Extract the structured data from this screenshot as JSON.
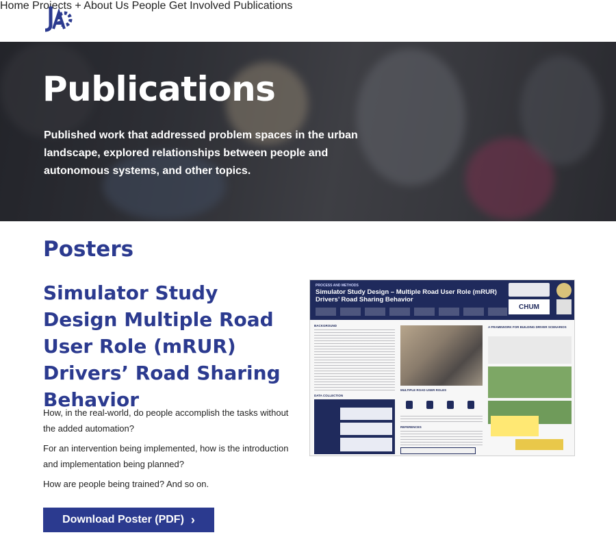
{
  "header": {
    "logo_alt": "logo",
    "nav": [
      {
        "label": "Home"
      },
      {
        "label": "Projects +"
      },
      {
        "label": "About Us"
      },
      {
        "label": "People"
      },
      {
        "label": "Get Involved"
      },
      {
        "label": "Publications"
      }
    ]
  },
  "hero": {
    "title": "Publications",
    "subtitle": "Published work that addressed problem spaces in the urban landscape, explored relationships between people and autonomous systems, and other topics."
  },
  "posters": {
    "section_title": "Posters",
    "item": {
      "title": "Simulator Study Design Multiple Road User Role (mRUR) Drivers’ Road Sharing Behavior",
      "paragraphs": [
        "How, in the real-world, do people accomplish the tasks without the added automation?",
        "For an intervention being implemented, how is the introduction and implementation being planned?",
        "How are people being trained? And so on."
      ],
      "download_label": "Download Poster (PDF)",
      "poster_image": {
        "header_label": "PROCESS AND METHODS",
        "header_title": "Simulator Study Design – Multiple Road User Role (mRUR) Drivers’ Road Sharing Behavior",
        "logo_text": "CHUM",
        "sections": [
          "BACKGROUND",
          "DATA COLLECTION",
          "MULTIPLE ROAD USER ROLES",
          "REFERENCES",
          "A FRAMEWORK FOR BUILDING DRIVER SCENARIOS"
        ]
      }
    }
  },
  "colors": {
    "brand": "#2b3a8f",
    "poster_navy": "#1f2a5c"
  }
}
